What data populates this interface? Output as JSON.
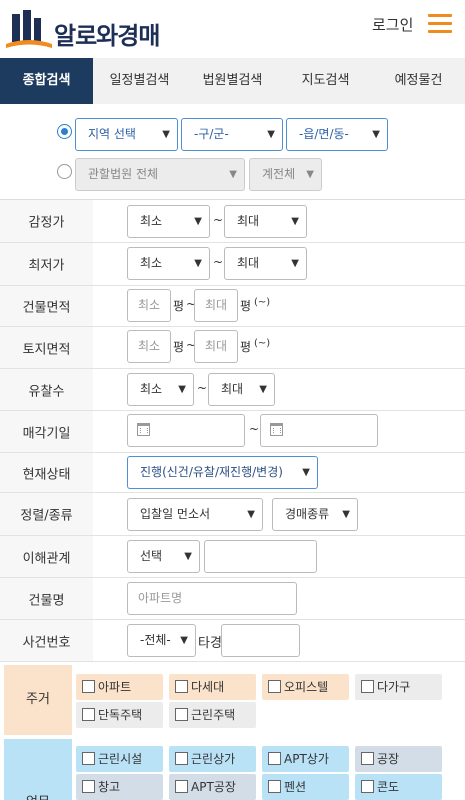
{
  "header": {
    "logo_text": "알로와경매",
    "login_label": "로그인"
  },
  "tabs": [
    "종합검색",
    "일정별검색",
    "법원별검색",
    "지도검색",
    "예정물건"
  ],
  "region": {
    "area_select": "지역 선택",
    "district_select": "-구/군-",
    "town_select": "-읍/면/동-",
    "court_select": "관할법원 전체",
    "branch_select": "계전체"
  },
  "form": {
    "appraisal": {
      "label": "감정가",
      "min": "최소",
      "max": "최대",
      "sep": "~"
    },
    "minimum": {
      "label": "최저가",
      "min": "최소",
      "max": "최대",
      "sep": "~"
    },
    "building_area": {
      "label": "건물면적",
      "min_placeholder": "최소",
      "max_placeholder": "최대",
      "unit": "평",
      "sep": "~",
      "note": "(~)"
    },
    "land_area": {
      "label": "토지면적",
      "min_placeholder": "최소",
      "max_placeholder": "최대",
      "unit": "평",
      "sep": "~",
      "note": "(~)"
    },
    "failed_count": {
      "label": "유찰수",
      "min": "최소",
      "max": "최대",
      "sep": "~"
    },
    "sale_date": {
      "label": "매각기일",
      "sep": "~"
    },
    "status": {
      "label": "현재상태",
      "value": "진행(신건/유찰/재진행/변경)"
    },
    "sort": {
      "label": "정렬/종류",
      "order": "입찰일 먼소서",
      "kind": "경매종류"
    },
    "interest": {
      "label": "이해관계",
      "select": "선택"
    },
    "building_name": {
      "label": "건물명",
      "placeholder": "아파트명"
    },
    "case_no": {
      "label": "사건번호",
      "select": "-전체-",
      "suffix": "타경"
    }
  },
  "categories": {
    "residential": {
      "label": "주거",
      "items": [
        "아파트",
        "다세대",
        "오피스텔",
        "다가구",
        "단독주택",
        "근린주택"
      ]
    },
    "commercial": {
      "label": "업무",
      "items": [
        "근린시설",
        "근린상가",
        "APT상가",
        "공장",
        "창고",
        "APT공장",
        "펜션",
        "콘도"
      ]
    }
  },
  "colors": {
    "tab_active": "#1d3a5f",
    "accent_orange": "#f08b1d",
    "residential_bg": "#fbe3cb",
    "residential_gray": "#ececec",
    "commercial_blue": "#b9e2f7",
    "commercial_gray": "#d3dde7",
    "commercial_label_bg": "#b9e2f7"
  },
  "icons": [
    "logo-building-icon",
    "hamburger-menu-icon",
    "calendar-icon",
    "dropdown-arrow-icon",
    "checkbox-icon"
  ]
}
